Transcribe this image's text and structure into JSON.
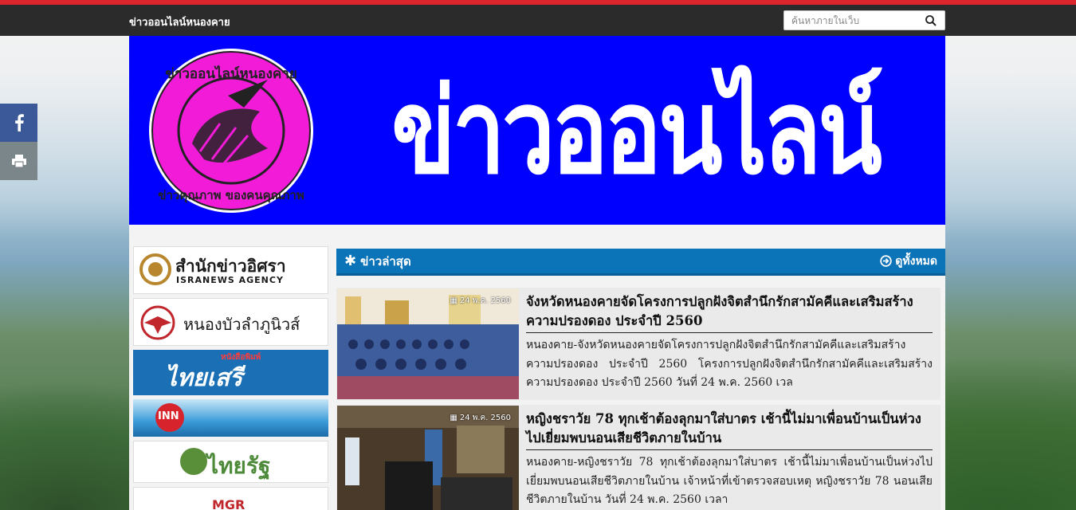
{
  "topbar": {
    "site_name": "ข่าวออนไลน์หนองคาย",
    "search_placeholder": "ค้นหาภายในเว็บ"
  },
  "banner": {
    "title": "ข่าวออนไลน์หนองคาย",
    "logo_top_text": "ข่าวออนไลน์หนองคาย",
    "logo_bottom_text": "ข่าวคุณภาพ ของคนคุณภาพ"
  },
  "social": {
    "facebook_icon": "facebook-icon",
    "print_icon": "print-icon"
  },
  "sidebar": {
    "ads": [
      {
        "name": "สำนักข่าวอิศรา",
        "sub": "ISRANEWS AGENCY"
      },
      {
        "name": "หนองบัวลำภูนิวส์"
      },
      {
        "name": "ไทยเสรี",
        "sub": "หนังสือพิมพ์"
      },
      {
        "name": "INN"
      },
      {
        "name": "ไทยรัฐ"
      },
      {
        "name": "MGR"
      }
    ]
  },
  "news": {
    "section_title": "ข่าวล่าสุด",
    "see_all": "ดูทั้งหมด",
    "items": [
      {
        "date": "24 พ.ค. 2560",
        "title": "จังหวัดหนองคายจัดโครงการปลูกฝังจิตสำนึกรักสามัคคีและเสริมสร้างความปรองดอง ประจำปี 2560",
        "desc": "หนองคาย-จังหวัดหนองคายจัดโครงการปลูกฝังจิตสำนึกรักสามัคคีและเสริมสร้างความปรองดอง ประจำปี 2560 โครงการปลูกฝังจิตสำนึกรักสามัคคีและเสริมสร้างความปรองดอง ประจำปี 2560 วันที่ 24 พ.ค. 2560  เวล"
      },
      {
        "date": "24 พ.ค. 2560",
        "title": "หญิงชราวัย 78 ทุกเช้าต้องลุกมาใส่บาตร เช้านี้ไม่มาเพื่อนบ้านเป็นห่วงไปเยี่ยมพบนอนเสียชีวิตภายในบ้าน",
        "desc": "หนองคาย-หญิงชราวัย 78 ทุกเช้าต้องลุกมาใส่บาตร เช้านี้ไม่มาเพื่อนบ้านเป็นห่วงไปเยี่ยมพบนอนเสียชีวิตภายในบ้าน     เจ้าหน้าที่เข้าตรวจสอบเหตุ หญิงชราวัย 78 นอนเสียชีวิตภายในบ้าน วันที่ 24 พ.ค. 2560 เวลา"
      }
    ]
  },
  "colors": {
    "banner_blue": "#0000ff",
    "topbar": "#2b2b2b",
    "accent_red": "#d9252b",
    "news_header": "#0b73b8",
    "logo_pink": "#f21bd8"
  }
}
